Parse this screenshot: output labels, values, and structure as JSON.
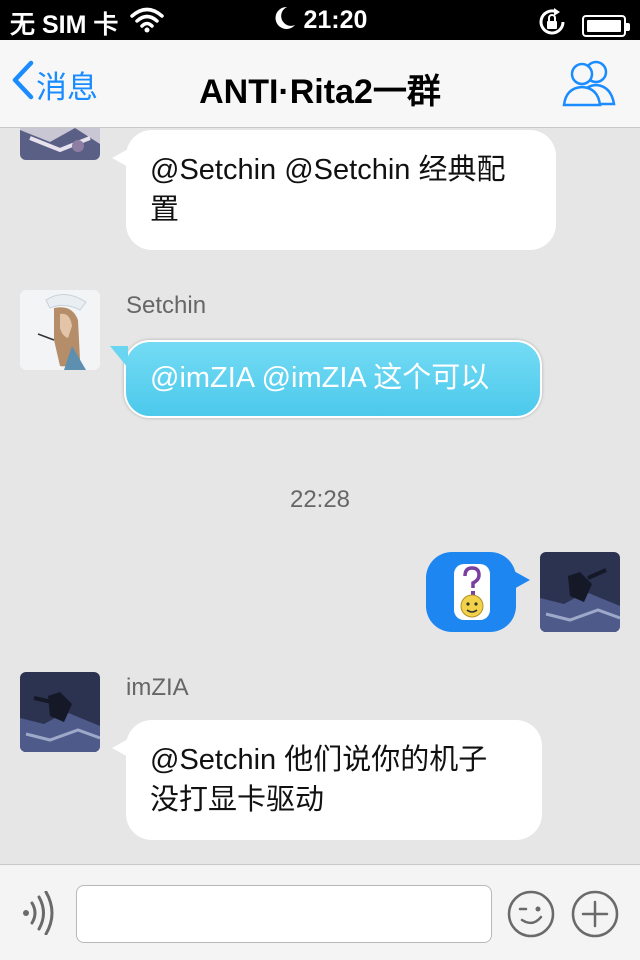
{
  "status_bar": {
    "carrier": "无 SIM 卡",
    "time": "21:20"
  },
  "nav": {
    "back_label": "消息",
    "title": "ANTI·Rita2一群"
  },
  "messages": [
    {
      "sender": "",
      "text": "@Setchin @Setchin 经典配置",
      "line1": "@Setchin @Setchin 经典配",
      "line2": "置"
    },
    {
      "sender": "Setchin",
      "text": "@imZIA @imZIA 这个可以"
    },
    {
      "timestamp": "22:28"
    },
    {
      "sender": "me",
      "sticker": "question-smiley"
    },
    {
      "sender": "imZIA",
      "text": "@Setchin 他们说你的机子没打显卡驱动",
      "line1": "@Setchin 他们说你的机子",
      "line2": "没打显卡驱动"
    }
  ],
  "input": {
    "value": "",
    "placeholder": ""
  },
  "colors": {
    "accent": "#1a8cff",
    "cyan_bubble": "#4cc9ec",
    "blue_bubble": "#1d86f1",
    "background": "#e6e6e6"
  }
}
